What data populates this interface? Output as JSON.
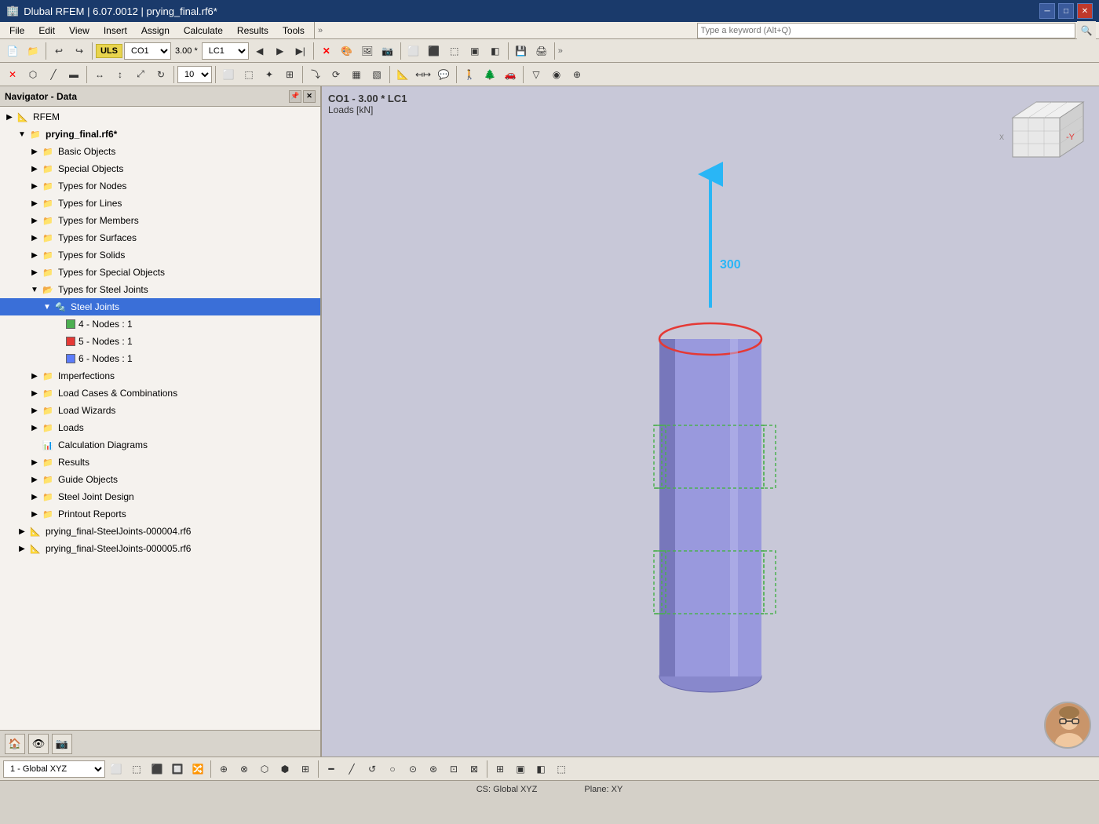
{
  "titleBar": {
    "title": "Dlubal RFEM | 6.07.0012 | prying_final.rf6*",
    "icon": "🏢",
    "btnMin": "─",
    "btnMax": "□",
    "btnClose": "✕"
  },
  "menuBar": {
    "items": [
      "File",
      "Edit",
      "View",
      "Insert",
      "Assign",
      "Calculate",
      "Results",
      "Tools"
    ]
  },
  "searchBar": {
    "placeholder": "Type a keyword (Alt+Q)"
  },
  "toolbar1": {
    "uls": "ULS",
    "combo": "CO1",
    "scale": "3.00",
    "lc": "LC1"
  },
  "navigator": {
    "title": "Navigator - Data",
    "rfem": "RFEM",
    "project": "prying_final.rf6*",
    "treeItems": [
      {
        "label": "Basic Objects",
        "indent": 1,
        "type": "folder",
        "arrow": "▶",
        "expanded": false
      },
      {
        "label": "Special Objects",
        "indent": 1,
        "type": "folder",
        "arrow": "▶",
        "expanded": false
      },
      {
        "label": "Types for Nodes",
        "indent": 1,
        "type": "folder",
        "arrow": "▶",
        "expanded": false
      },
      {
        "label": "Types for Lines",
        "indent": 1,
        "type": "folder",
        "arrow": "▶",
        "expanded": false
      },
      {
        "label": "Types for Members",
        "indent": 1,
        "type": "folder",
        "arrow": "▶",
        "expanded": false
      },
      {
        "label": "Types for Surfaces",
        "indent": 1,
        "type": "folder",
        "arrow": "▶",
        "expanded": false
      },
      {
        "label": "Types for Solids",
        "indent": 1,
        "type": "folder",
        "arrow": "▶",
        "expanded": false
      },
      {
        "label": "Types for Special Objects",
        "indent": 1,
        "type": "folder",
        "arrow": "▶",
        "expanded": false
      },
      {
        "label": "Types for Steel Joints",
        "indent": 1,
        "type": "folder",
        "arrow": "▼",
        "expanded": true
      },
      {
        "label": "Steel Joints",
        "indent": 2,
        "type": "folder-selected",
        "arrow": "▼",
        "expanded": true,
        "selected": true
      },
      {
        "label": "4 - Nodes : 1",
        "indent": 3,
        "type": "node",
        "color": "#4caf50"
      },
      {
        "label": "5 - Nodes : 1",
        "indent": 3,
        "type": "node",
        "color": "#e53935"
      },
      {
        "label": "6 - Nodes : 1",
        "indent": 3,
        "type": "node",
        "color": "#5c7cfa"
      },
      {
        "label": "Imperfections",
        "indent": 1,
        "type": "folder",
        "arrow": "▶",
        "expanded": false
      },
      {
        "label": "Load Cases & Combinations",
        "indent": 1,
        "type": "folder",
        "arrow": "▶",
        "expanded": false
      },
      {
        "label": "Load Wizards",
        "indent": 1,
        "type": "folder",
        "arrow": "▶",
        "expanded": false
      },
      {
        "label": "Loads",
        "indent": 1,
        "type": "folder",
        "arrow": "▶",
        "expanded": false
      },
      {
        "label": "Calculation Diagrams",
        "indent": 1,
        "type": "plain",
        "icon": "📊"
      },
      {
        "label": "Results",
        "indent": 1,
        "type": "folder",
        "arrow": "▶",
        "expanded": false
      },
      {
        "label": "Guide Objects",
        "indent": 1,
        "type": "folder",
        "arrow": "▶",
        "expanded": false
      },
      {
        "label": "Steel Joint Design",
        "indent": 1,
        "type": "folder",
        "arrow": "▶",
        "expanded": false
      },
      {
        "label": "Printout Reports",
        "indent": 1,
        "type": "folder",
        "arrow": "▶",
        "expanded": false
      }
    ],
    "subProjects": [
      {
        "label": "prying_final-SteelJoints-000004.rf6",
        "icon": "📄"
      },
      {
        "label": "prying_final-SteelJoints-000005.rf6",
        "icon": "📄"
      }
    ]
  },
  "viewport": {
    "coLabel": "CO1 - 3.00 * LC1",
    "loadsLabel": "Loads [kN]",
    "loadValue": "300",
    "coordSystem": "1 - Global XYZ",
    "csInfo": "CS: Global XYZ",
    "planeInfo": "Plane: XY"
  },
  "statusBar": {
    "cs": "CS: Global XYZ",
    "plane": "Plane: XY"
  }
}
